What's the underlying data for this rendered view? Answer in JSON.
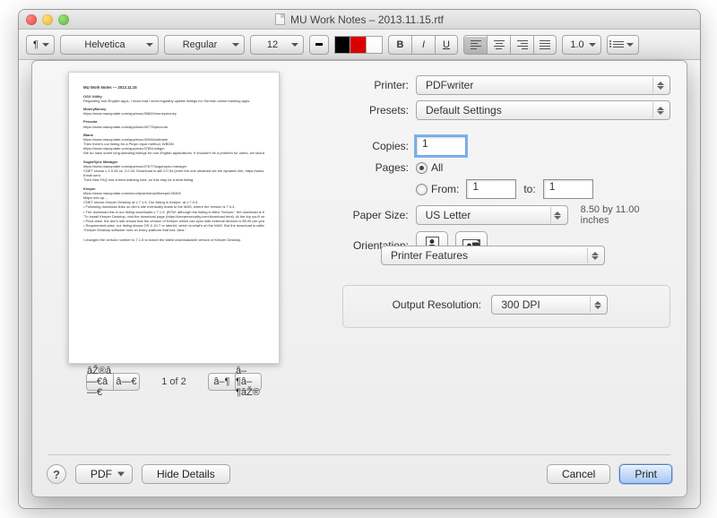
{
  "window": {
    "title": "MU Work Notes – 2013.11.15.rtf"
  },
  "toolbar": {
    "style": "¶",
    "font": "Helvetica",
    "weight": "Regular",
    "size": "12",
    "bold": "B",
    "italic": "I",
    "underline": "U",
    "linespacing": "1.0"
  },
  "preview": {
    "title": "MU Work Notes — 2013.11.15",
    "page_indicator": "1 of 2"
  },
  "print": {
    "labels": {
      "printer": "Printer:",
      "presets": "Presets:",
      "copies": "Copies:",
      "pages": "Pages:",
      "all": "All",
      "from": "From:",
      "to": "to:",
      "paper_size": "Paper Size:",
      "orientation": "Orientation:",
      "output_resolution": "Output Resolution:"
    },
    "printer": "PDFwriter",
    "presets": "Default Settings",
    "copies": "1",
    "pages_mode": "all",
    "from": "1",
    "to": "1",
    "paper_size": "US Letter",
    "paper_dims": "8.50 by 11.00 inches",
    "features_section": "Printer Features",
    "output_resolution": "300 DPI"
  },
  "buttons": {
    "help": "?",
    "pdf": "PDF",
    "hide_details": "Hide Details",
    "cancel": "Cancel",
    "print": "Print"
  }
}
